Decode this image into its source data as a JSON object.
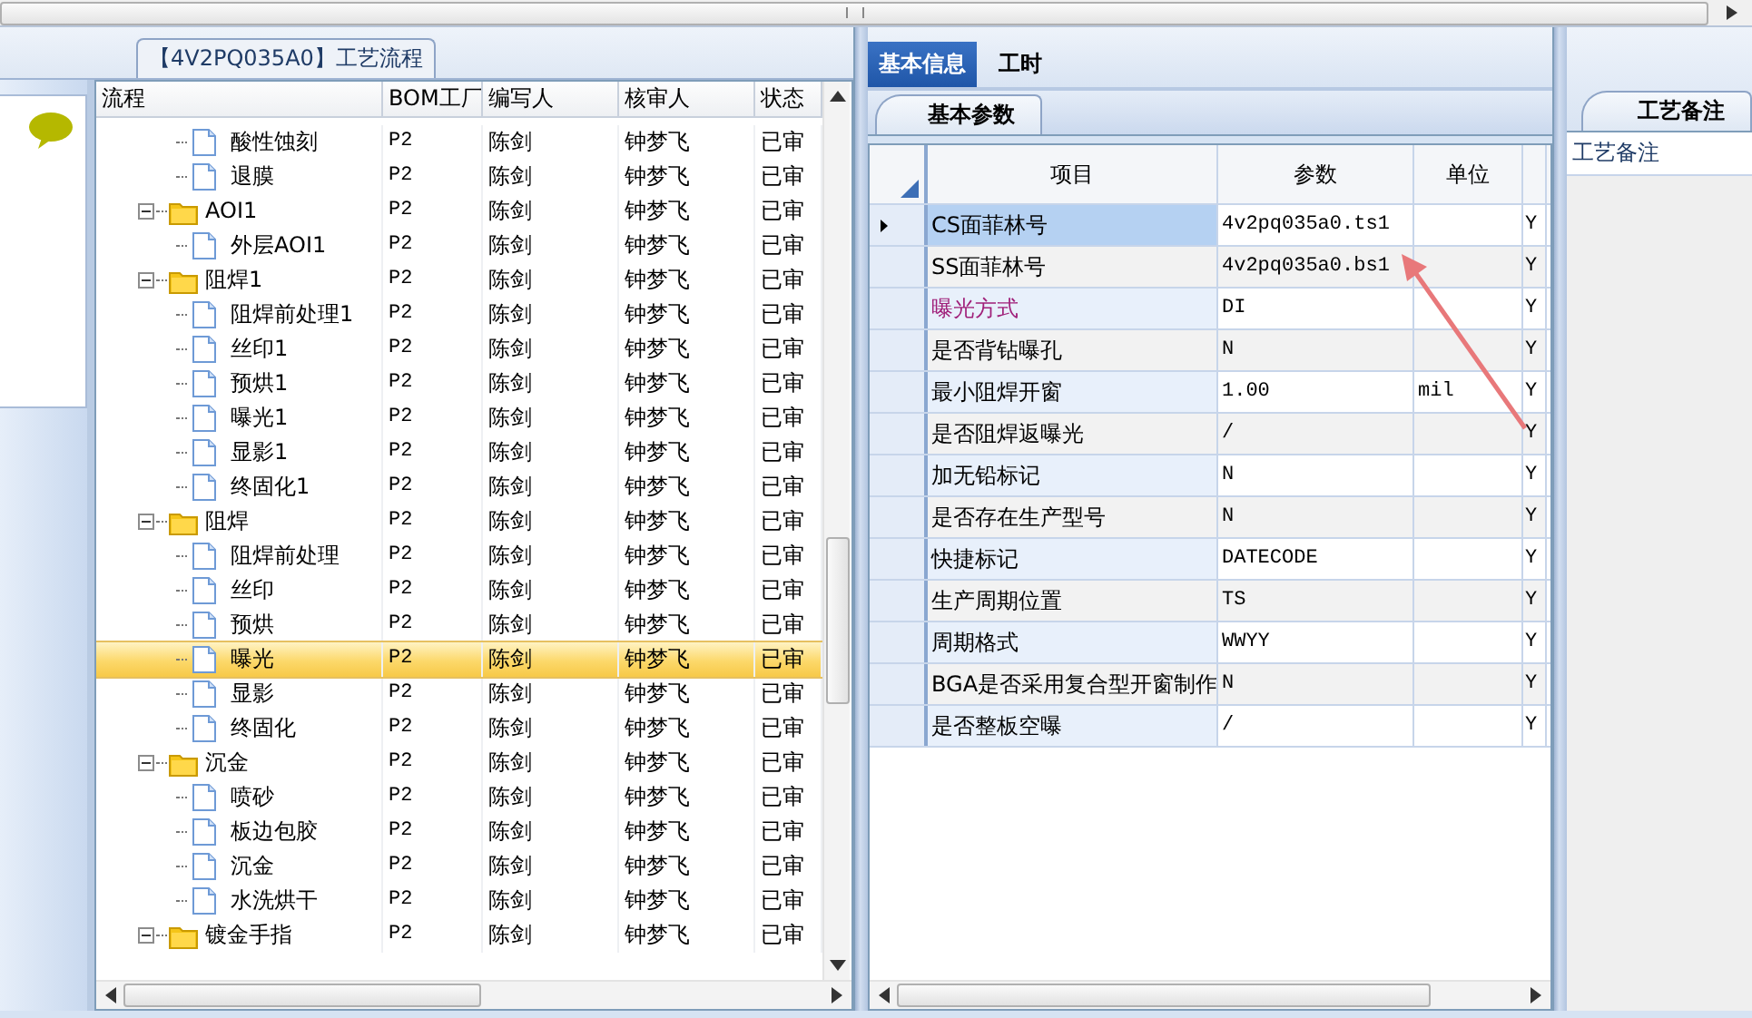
{
  "flow_panel": {
    "title": "【4V2PQ035A0】工艺流程",
    "columns": [
      "流程",
      "BOM工厂",
      "编写人",
      "核审人",
      "状态"
    ],
    "rows": [
      {
        "label": "酸性蚀刻",
        "kind": "leaf",
        "bom": "P2",
        "writer": "陈剑",
        "reviewer": "钟梦飞",
        "status": "已审",
        "selected": false
      },
      {
        "label": "退膜",
        "kind": "leaf",
        "bom": "P2",
        "writer": "陈剑",
        "reviewer": "钟梦飞",
        "status": "已审",
        "selected": false
      },
      {
        "label": "AOI1",
        "kind": "folder",
        "expanded": true,
        "bom": "P2",
        "writer": "陈剑",
        "reviewer": "钟梦飞",
        "status": "已审",
        "selected": false,
        "children": [
          {
            "label": "外层AOI1",
            "kind": "leaf",
            "bom": "P2",
            "writer": "陈剑",
            "reviewer": "钟梦飞",
            "status": "已审",
            "selected": false
          }
        ]
      },
      {
        "label": "阻焊1",
        "kind": "folder",
        "expanded": true,
        "bom": "P2",
        "writer": "陈剑",
        "reviewer": "钟梦飞",
        "status": "已审",
        "selected": false,
        "children": [
          {
            "label": "阻焊前处理1",
            "kind": "leaf",
            "bom": "P2",
            "writer": "陈剑",
            "reviewer": "钟梦飞",
            "status": "已审",
            "selected": false
          },
          {
            "label": "丝印1",
            "kind": "leaf",
            "bom": "P2",
            "writer": "陈剑",
            "reviewer": "钟梦飞",
            "status": "已审",
            "selected": false
          },
          {
            "label": "预烘1",
            "kind": "leaf",
            "bom": "P2",
            "writer": "陈剑",
            "reviewer": "钟梦飞",
            "status": "已审",
            "selected": false
          },
          {
            "label": "曝光1",
            "kind": "leaf",
            "bom": "P2",
            "writer": "陈剑",
            "reviewer": "钟梦飞",
            "status": "已审",
            "selected": false
          },
          {
            "label": "显影1",
            "kind": "leaf",
            "bom": "P2",
            "writer": "陈剑",
            "reviewer": "钟梦飞",
            "status": "已审",
            "selected": false
          },
          {
            "label": "终固化1",
            "kind": "leaf",
            "bom": "P2",
            "writer": "陈剑",
            "reviewer": "钟梦飞",
            "status": "已审",
            "selected": false
          }
        ]
      },
      {
        "label": "阻焊",
        "kind": "folder",
        "expanded": true,
        "bom": "P2",
        "writer": "陈剑",
        "reviewer": "钟梦飞",
        "status": "已审",
        "selected": false,
        "children": [
          {
            "label": "阻焊前处理",
            "kind": "leaf",
            "bom": "P2",
            "writer": "陈剑",
            "reviewer": "钟梦飞",
            "status": "已审",
            "selected": false
          },
          {
            "label": "丝印",
            "kind": "leaf",
            "bom": "P2",
            "writer": "陈剑",
            "reviewer": "钟梦飞",
            "status": "已审",
            "selected": false
          },
          {
            "label": "预烘",
            "kind": "leaf",
            "bom": "P2",
            "writer": "陈剑",
            "reviewer": "钟梦飞",
            "status": "已审",
            "selected": false
          },
          {
            "label": "曝光",
            "kind": "leaf",
            "bom": "P2",
            "writer": "陈剑",
            "reviewer": "钟梦飞",
            "status": "已审",
            "selected": true
          },
          {
            "label": "显影",
            "kind": "leaf",
            "bom": "P2",
            "writer": "陈剑",
            "reviewer": "钟梦飞",
            "status": "已审",
            "selected": false
          },
          {
            "label": "终固化",
            "kind": "leaf",
            "bom": "P2",
            "writer": "陈剑",
            "reviewer": "钟梦飞",
            "status": "已审",
            "selected": false
          }
        ]
      },
      {
        "label": "沉金",
        "kind": "folder",
        "expanded": true,
        "bom": "P2",
        "writer": "陈剑",
        "reviewer": "钟梦飞",
        "status": "已审",
        "selected": false,
        "children": [
          {
            "label": "喷砂",
            "kind": "leaf",
            "bom": "P2",
            "writer": "陈剑",
            "reviewer": "钟梦飞",
            "status": "已审",
            "selected": false
          },
          {
            "label": "板边包胶",
            "kind": "leaf",
            "bom": "P2",
            "writer": "陈剑",
            "reviewer": "钟梦飞",
            "status": "已审",
            "selected": false
          },
          {
            "label": "沉金",
            "kind": "leaf",
            "bom": "P2",
            "writer": "陈剑",
            "reviewer": "钟梦飞",
            "status": "已审",
            "selected": false
          },
          {
            "label": "水洗烘干",
            "kind": "leaf",
            "bom": "P2",
            "writer": "陈剑",
            "reviewer": "钟梦飞",
            "status": "已审",
            "selected": false
          }
        ]
      },
      {
        "label": "镀金手指",
        "kind": "folder",
        "expanded": true,
        "bom": "P2",
        "writer": "陈剑",
        "reviewer": "钟梦飞",
        "status": "已审",
        "selected": false
      }
    ]
  },
  "info_tabs": [
    {
      "label": "基本信息",
      "selected": true
    },
    {
      "label": "工时",
      "selected": false
    }
  ],
  "sub_tab": {
    "label": "基本参数"
  },
  "params": {
    "columns": [
      "项目",
      "参数",
      "单位"
    ],
    "rows": [
      {
        "item": "CS面菲林号",
        "value": "4v2pq035a0.ts1",
        "flag": "Y",
        "color": "#000000",
        "selected": true
      },
      {
        "item": "SS面菲林号",
        "value": "4v2pq035a0.bs1",
        "flag": "Y",
        "color": "#000000",
        "selected": false
      },
      {
        "item": "曝光方式",
        "value": "DI",
        "flag": "Y",
        "color": "#a0207a",
        "selected": false
      },
      {
        "item": "是否背钻曝孔",
        "value": "N",
        "flag": "Y",
        "color": "#000000",
        "selected": false
      },
      {
        "item": "最小阻焊开窗",
        "value": "1.00",
        "unit": "mil",
        "flag": "Y",
        "color": "#000000",
        "selected": false
      },
      {
        "item": "是否阻焊返曝光",
        "value": "/",
        "flag": "Y",
        "color": "#000000",
        "selected": false
      },
      {
        "item": "加无铅标记",
        "value": "N",
        "flag": "Y",
        "color": "#000000",
        "selected": false
      },
      {
        "item": "是否存在生产型号",
        "value": "N",
        "flag": "Y",
        "color": "#000000",
        "selected": false
      },
      {
        "item": "快捷标记",
        "value": "DATECODE",
        "flag": "Y",
        "color": "#000000",
        "selected": false
      },
      {
        "item": "生产周期位置",
        "value": "TS",
        "flag": "Y",
        "color": "#000000",
        "selected": false
      },
      {
        "item": "周期格式",
        "value": "WWYY",
        "flag": "Y",
        "color": "#000000",
        "selected": false
      },
      {
        "item": "BGA是否采用复合型开窗制作",
        "value": "N",
        "flag": "Y",
        "color": "#000000",
        "selected": false
      },
      {
        "item": "是否整板空曝",
        "value": "/",
        "flag": "Y",
        "color": "#000000",
        "selected": false
      }
    ]
  },
  "notes_panel": {
    "tab": "工艺备注",
    "label": "工艺备注"
  },
  "annotation": {
    "kind": "arrow"
  }
}
